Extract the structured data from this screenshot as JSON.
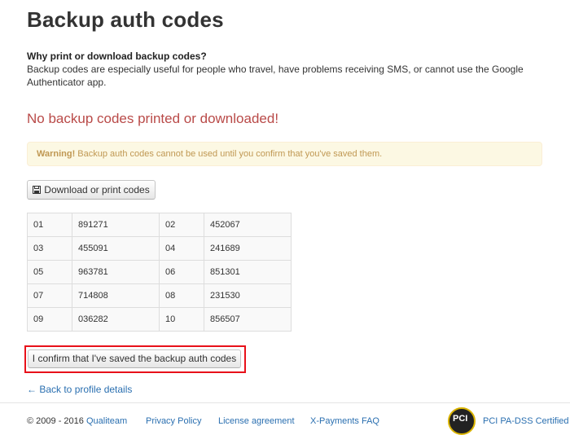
{
  "page": {
    "title": "Backup auth codes",
    "why_title": "Why print or download backup codes?",
    "why_text": "Backup codes are especially useful for people who travel, have problems receiving SMS, or cannot use the Google Authenticator app.",
    "no_codes_message": "No backup codes printed or downloaded!",
    "warning_strong": "Warning!",
    "warning_text": " Backup auth codes cannot be used until you confirm that you've saved them.",
    "download_button": "Download or print codes",
    "confirm_button": "I confirm that I've saved the backup auth codes",
    "back_link": "← Back to profile details"
  },
  "codes": {
    "rows": [
      [
        {
          "idx": "01",
          "code": "891271"
        },
        {
          "idx": "02",
          "code": "452067"
        }
      ],
      [
        {
          "idx": "03",
          "code": "455091"
        },
        {
          "idx": "04",
          "code": "241689"
        }
      ],
      [
        {
          "idx": "05",
          "code": "963781"
        },
        {
          "idx": "06",
          "code": "851301"
        }
      ],
      [
        {
          "idx": "07",
          "code": "714808"
        },
        {
          "idx": "08",
          "code": "231530"
        }
      ],
      [
        {
          "idx": "09",
          "code": "036282"
        },
        {
          "idx": "10",
          "code": "856507"
        }
      ]
    ]
  },
  "footer": {
    "copyright": "© 2009 - 2016",
    "company": "Qualiteam",
    "privacy": "Privacy Policy",
    "license": "License agreement",
    "faq": "X-Payments FAQ",
    "pci_badge": "PCI",
    "pci": "PCI PA-DSS Certified"
  },
  "colors": {
    "danger": "#b94a48",
    "warning_bg": "#fcf8e3",
    "warning_text": "#c09853",
    "link": "#2a6fb0",
    "highlight_border": "#e8111a"
  }
}
